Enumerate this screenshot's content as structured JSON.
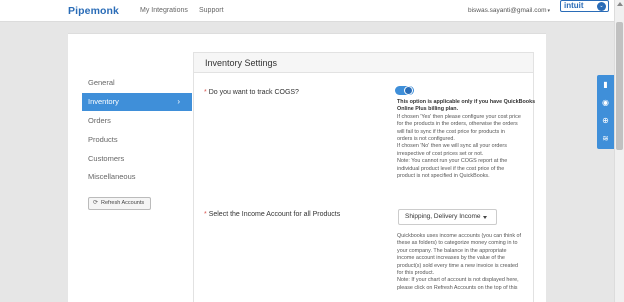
{
  "header": {
    "logo": "Pipemonk",
    "nav": [
      "My Integrations",
      "Support"
    ],
    "user_email": "biswas.sayanti@gmail.com",
    "user_caret": "▾",
    "intuit_logo": "intuit",
    "intuit_badge": "⌄"
  },
  "sidebar": {
    "items": [
      {
        "label": "General"
      },
      {
        "label": "Inventory"
      },
      {
        "label": "Orders"
      },
      {
        "label": "Products"
      },
      {
        "label": "Customers"
      },
      {
        "label": "Miscellaneous"
      }
    ],
    "active_chevron": "›",
    "refresh_label": "Refresh Accounts",
    "refresh_icon": "⟳"
  },
  "panel": {
    "title": "Inventory Settings",
    "cogs": {
      "required_mark": "*",
      "label": "Do you want to track COGS?",
      "toggle_on": true,
      "help_bold": "This option is applicable only if you have QuickBooks Online Plus billing plan.",
      "help_lines": [
        "If chosen 'Yes' then please configure your cost price",
        "for the products in the orders, otherwise the orders",
        "will fail to sync if the cost price for products in",
        "orders is not configured.",
        "If chosen 'No' then we will sync all your orders",
        "irrespective of cost prices set or not.",
        "Note: You cannot run your COGS report at the",
        "individual product level if the cost price of the",
        "product is not specified in QuickBooks."
      ]
    },
    "income": {
      "required_mark": "*",
      "label": "Select the Income Account for all Products",
      "selected": "Shipping, Delivery Income",
      "help_lines": [
        "Quickbooks uses income accounts (you can think of",
        "these as folders) to categorize money coming in to",
        "your company. The balance in the appropriate",
        "income account increases by the value of the",
        "product(s) sold every time a new invoice is created",
        "for this product.",
        "Note: If your chart of account is not displayed here,",
        "please click on Refresh Accounts on the top of this"
      ]
    }
  },
  "float_icons": [
    {
      "name": "book-icon",
      "glyph": "▮"
    },
    {
      "name": "help-icon",
      "glyph": "◉"
    },
    {
      "name": "add-icon",
      "glyph": "⊕"
    },
    {
      "name": "rss-icon",
      "glyph": "≋"
    }
  ],
  "colors": {
    "accent": "#3f8fd9",
    "brand": "#2a6cb7",
    "required": "#d9534f"
  }
}
